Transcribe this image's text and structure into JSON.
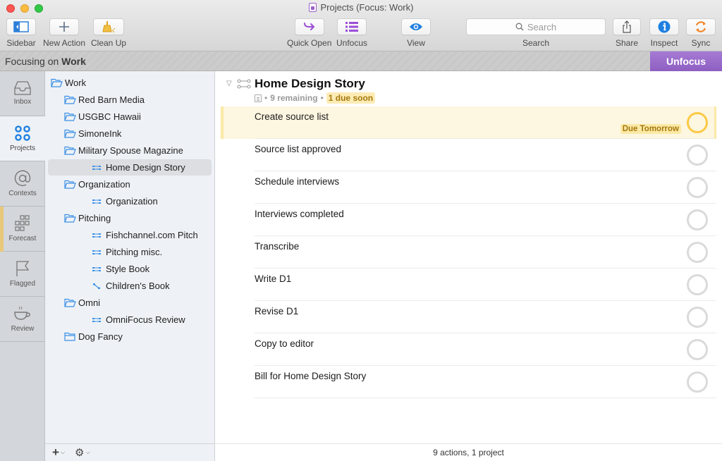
{
  "window": {
    "title": "Projects (Focus: Work)"
  },
  "toolbar": {
    "sidebar_label": "Sidebar",
    "new_action_label": "New Action",
    "clean_up_label": "Clean Up",
    "quick_open_label": "Quick Open",
    "unfocus_label": "Unfocus",
    "view_label": "View",
    "search_placeholder": "Search",
    "search_label": "Search",
    "share_label": "Share",
    "inspect_label": "Inspect",
    "sync_label": "Sync"
  },
  "focus_bar": {
    "prefix": "Focusing on",
    "focus_name": "Work",
    "unfocus_button": "Unfocus"
  },
  "perspectives": [
    {
      "label": "Inbox",
      "icon": "inbox-icon"
    },
    {
      "label": "Projects",
      "icon": "projects-icon",
      "active": true
    },
    {
      "label": "Contexts",
      "icon": "at-sign-icon"
    },
    {
      "label": "Forecast",
      "icon": "forecast-grid-icon"
    },
    {
      "label": "Flagged",
      "icon": "flag-icon"
    },
    {
      "label": "Review",
      "icon": "coffee-cup-icon"
    }
  ],
  "sidebar": {
    "tree": [
      {
        "label": "Work",
        "type": "folder",
        "level": 0
      },
      {
        "label": "Red Barn Media",
        "type": "folder",
        "level": 1
      },
      {
        "label": "USGBC Hawaii",
        "type": "folder",
        "level": 1
      },
      {
        "label": "SimoneInk",
        "type": "folder",
        "level": 1
      },
      {
        "label": "Military Spouse Magazine",
        "type": "folder",
        "level": 1
      },
      {
        "label": "Home Design Story",
        "type": "parallel-project",
        "level": 2,
        "selected": true
      },
      {
        "label": "Organization",
        "type": "folder",
        "level": 1
      },
      {
        "label": "Organization",
        "type": "parallel-project",
        "level": 2
      },
      {
        "label": "Pitching",
        "type": "folder",
        "level": 1
      },
      {
        "label": "Fishchannel.com Pitch",
        "type": "parallel-project",
        "level": 2
      },
      {
        "label": "Pitching misc.",
        "type": "parallel-project",
        "level": 2
      },
      {
        "label": "Style Book",
        "type": "parallel-project",
        "level": 2
      },
      {
        "label": "Children's Book",
        "type": "sequential-project",
        "level": 2
      },
      {
        "label": "Omni",
        "type": "folder",
        "level": 1
      },
      {
        "label": "OmniFocus Review",
        "type": "parallel-project",
        "level": 2
      },
      {
        "label": "Dog Fancy",
        "type": "folder-closed",
        "level": 1
      }
    ],
    "footer": {
      "add_symbol": "+",
      "gear_symbol": "⚙"
    }
  },
  "project": {
    "title": "Home Design Story",
    "remaining": "9 remaining",
    "due_soon": "1 due soon",
    "separator": "•"
  },
  "tasks": [
    {
      "label": "Create source list",
      "due": "Due Tomorrow",
      "due_soon": true
    },
    {
      "label": "Source list approved"
    },
    {
      "label": "Schedule interviews"
    },
    {
      "label": "Interviews completed"
    },
    {
      "label": "Transcribe"
    },
    {
      "label": "Write D1"
    },
    {
      "label": "Revise D1"
    },
    {
      "label": "Copy to editor"
    },
    {
      "label": "Bill for Home Design Story"
    }
  ],
  "status": {
    "summary": "9 actions, 1 project"
  },
  "colors": {
    "accent_purple": "#9b5fc9",
    "folder_blue": "#3b8fe6",
    "due_soon_yellow": "#fbc945",
    "due_badge_bg": "#fbe9a6",
    "due_text": "#a6780d"
  }
}
